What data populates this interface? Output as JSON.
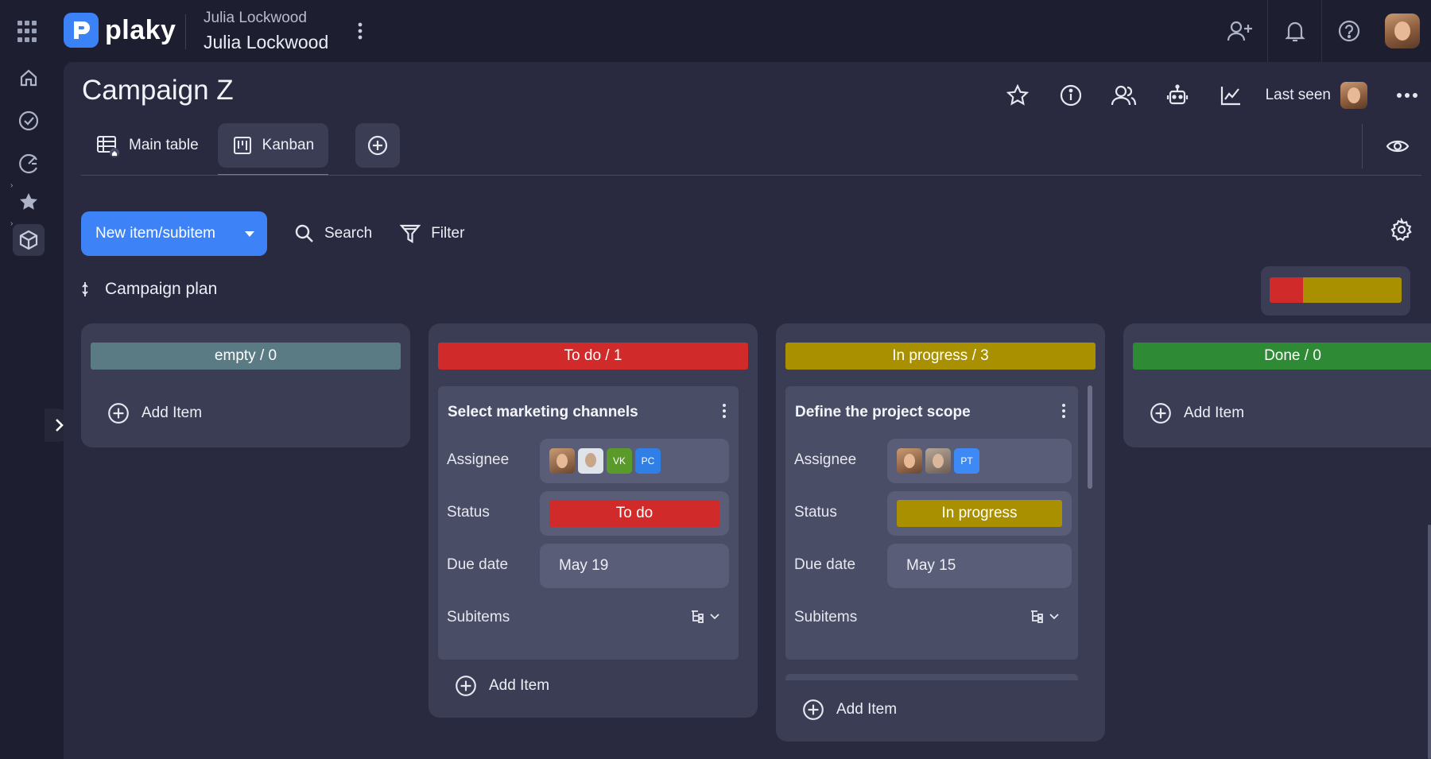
{
  "app": {
    "brand": "plaky",
    "workspace_top": "Julia Lockwood",
    "workspace_name": "Julia Lockwood"
  },
  "board": {
    "title": "Campaign Z",
    "last_seen_label": "Last seen"
  },
  "tabs": [
    {
      "label": "Main table"
    },
    {
      "label": "Kanban"
    }
  ],
  "toolbar": {
    "new_item_label": "New item/subitem",
    "search_label": "Search",
    "filter_label": "Filter"
  },
  "group": {
    "name": "Campaign plan",
    "progress": [
      {
        "color": "#d02a2a",
        "fraction": 0.25
      },
      {
        "color": "#a89000",
        "fraction": 0.75
      }
    ]
  },
  "columns": [
    {
      "header": "empty / 0",
      "color": "#5a7a84",
      "add_label": "Add Item"
    },
    {
      "header": "To do / 1",
      "color": "#d02a2a",
      "add_label": "Add Item"
    },
    {
      "header": "In progress / 3",
      "color": "#a89000",
      "add_label": "Add Item"
    },
    {
      "header": "Done / 0",
      "color": "#2e8a35",
      "add_label": "Add Item"
    }
  ],
  "cards": [
    {
      "title": "Select marketing channels",
      "assignee_label": "Assignee",
      "assignees": [
        "face",
        "face",
        "VK",
        "PC"
      ],
      "status_label": "Status",
      "status": "To do",
      "status_color": "#d02a2a",
      "due_label": "Due date",
      "due": "May 19",
      "subitems_label": "Subitems"
    },
    {
      "title": "Define the project scope",
      "assignee_label": "Assignee",
      "assignees": [
        "face",
        "face",
        "PT"
      ],
      "status_label": "Status",
      "status": "In progress",
      "status_color": "#a89000",
      "due_label": "Due date",
      "due": "May 15",
      "subitems_label": "Subitems"
    }
  ],
  "badges": {
    "vk": "VK",
    "pc": "PC",
    "pt": "PT"
  },
  "colors": {
    "accent": "#3d82f6",
    "todo": "#d02a2a",
    "in_progress": "#a89000",
    "done": "#2e8a35",
    "empty": "#5a7a84"
  }
}
